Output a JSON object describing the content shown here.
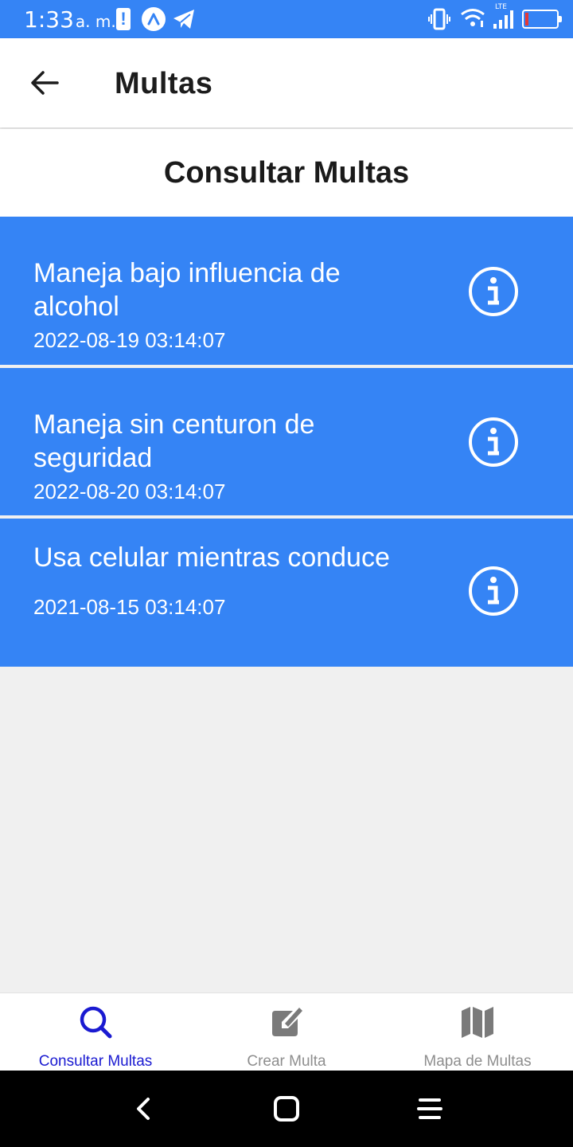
{
  "status_bar": {
    "time": "1:33",
    "ampm": "a. m.",
    "network_type": "LTE",
    "colors": {
      "background": "#3584f5",
      "battery_low": "#e53935"
    }
  },
  "header": {
    "title": "Multas"
  },
  "section": {
    "title": "Consultar Multas"
  },
  "fines": [
    {
      "title": "Maneja bajo influencia de alcohol",
      "date": "2022-08-19 03:14:07"
    },
    {
      "title": "Maneja sin centuron de seguridad",
      "date": "2022-08-20 03:14:07"
    },
    {
      "title": "Usa celular mientras conduce",
      "date": "2021-08-15 03:14:07"
    }
  ],
  "tabs": [
    {
      "label": "Consultar Multas",
      "icon": "search-icon",
      "active": true
    },
    {
      "label": "Crear Multa",
      "icon": "edit-icon",
      "active": false
    },
    {
      "label": "Mapa de Multas",
      "icon": "map-icon",
      "active": false
    }
  ],
  "colors": {
    "accent": "#3584f5",
    "active_tab": "#1a1ad1",
    "inactive_tab": "#8e8e8e",
    "list_background": "#f0f0f0"
  }
}
